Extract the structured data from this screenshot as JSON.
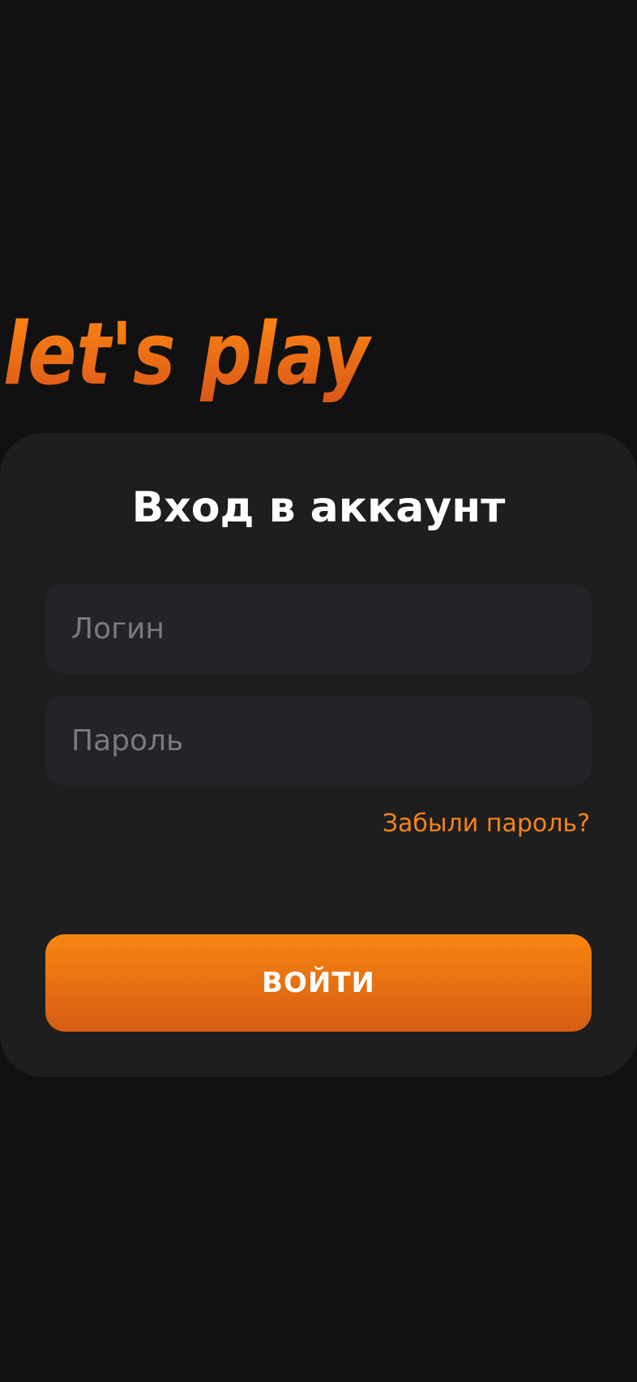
{
  "logo": {
    "text": "let's play",
    "color_top": "#ff8a12",
    "color_bottom": "#d9561a"
  },
  "login_form": {
    "title": "Вход в аккаунт",
    "login_placeholder": "Логин",
    "password_placeholder": "Пароль",
    "forgot_password_label": "Забыли пароль?",
    "submit_label": "ВОЙТИ"
  },
  "colors": {
    "background": "#111111",
    "card": "#1e1e1e",
    "input": "#242428",
    "accent": "#f58419"
  }
}
